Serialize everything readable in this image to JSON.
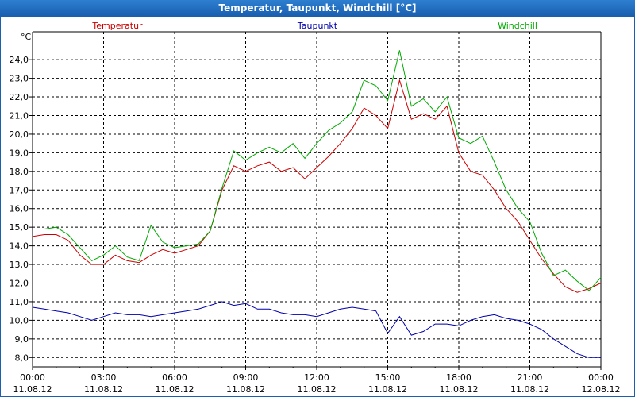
{
  "window": {
    "title": "Temperatur, Taupunkt, Windchill [°C]"
  },
  "colors": {
    "temperatur": "#cc0000",
    "taupunkt": "#0000aa",
    "windchill": "#00aa00"
  },
  "chart_data": {
    "type": "line",
    "yunit": "°C",
    "ylim": [
      7.5,
      25.5
    ],
    "yticks": [
      "8,0",
      "9,0",
      "10,0",
      "11,0",
      "12,0",
      "13,0",
      "14,0",
      "15,0",
      "16,0",
      "17,0",
      "18,0",
      "19,0",
      "20,0",
      "21,0",
      "22,0",
      "23,0",
      "24,0"
    ],
    "ytick_values": [
      8,
      9,
      10,
      11,
      12,
      13,
      14,
      15,
      16,
      17,
      18,
      19,
      20,
      21,
      22,
      23,
      24
    ],
    "xlim": [
      0,
      24
    ],
    "xticks": [
      {
        "x": 0,
        "time": "00:00",
        "date": "11.08.12"
      },
      {
        "x": 3,
        "time": "03:00",
        "date": "11.08.12"
      },
      {
        "x": 6,
        "time": "06:00",
        "date": "11.08.12"
      },
      {
        "x": 9,
        "time": "09:00",
        "date": "11.08.12"
      },
      {
        "x": 12,
        "time": "12:00",
        "date": "11.08.12"
      },
      {
        "x": 15,
        "time": "15:00",
        "date": "11.08.12"
      },
      {
        "x": 18,
        "time": "18:00",
        "date": "11.08.12"
      },
      {
        "x": 21,
        "time": "21:00",
        "date": "11.08.12"
      },
      {
        "x": 24,
        "time": "00:00",
        "date": "12.08.12"
      }
    ],
    "grid": true,
    "x": [
      0,
      0.5,
      1,
      1.5,
      2,
      2.5,
      3,
      3.5,
      4,
      4.5,
      5,
      5.5,
      6,
      6.5,
      7,
      7.5,
      8,
      8.5,
      9,
      9.5,
      10,
      10.5,
      11,
      11.5,
      12,
      12.5,
      13,
      13.5,
      14,
      14.5,
      15,
      15.5,
      16,
      16.5,
      17,
      17.5,
      18,
      18.5,
      19,
      19.5,
      20,
      20.5,
      21,
      21.5,
      22,
      22.5,
      23,
      23.5,
      24
    ],
    "series": [
      {
        "name": "Temperatur",
        "values": [
          14.5,
          14.6,
          14.6,
          14.3,
          13.5,
          13.0,
          13.0,
          13.5,
          13.2,
          13.1,
          13.5,
          13.8,
          13.6,
          13.8,
          14.0,
          14.8,
          17.0,
          18.3,
          18.0,
          18.3,
          18.5,
          18.0,
          18.2,
          17.6,
          18.2,
          18.8,
          19.5,
          20.3,
          21.4,
          21.0,
          20.3,
          22.9,
          20.8,
          21.1,
          20.8,
          21.5,
          19.0,
          18.0,
          17.8,
          17.0,
          16.0,
          15.3,
          14.3,
          13.3,
          12.5,
          11.8,
          11.5,
          11.7,
          12.0
        ]
      },
      {
        "name": "Taupunkt",
        "values": [
          10.7,
          10.6,
          10.5,
          10.4,
          10.2,
          10.0,
          10.2,
          10.4,
          10.3,
          10.3,
          10.2,
          10.3,
          10.4,
          10.5,
          10.6,
          10.8,
          11.0,
          10.8,
          10.9,
          10.6,
          10.6,
          10.4,
          10.3,
          10.3,
          10.2,
          10.4,
          10.6,
          10.7,
          10.6,
          10.5,
          9.3,
          10.2,
          9.2,
          9.4,
          9.8,
          9.8,
          9.7,
          10.0,
          10.2,
          10.3,
          10.1,
          10.0,
          9.8,
          9.5,
          9.0,
          8.6,
          8.2,
          8.0,
          8.0
        ]
      },
      {
        "name": "Windchill",
        "values": [
          14.9,
          14.9,
          15.0,
          14.6,
          13.9,
          13.2,
          13.5,
          14.0,
          13.4,
          13.2,
          15.1,
          14.2,
          13.9,
          14.0,
          14.1,
          14.8,
          17.1,
          19.1,
          18.6,
          19.0,
          19.3,
          19.0,
          19.5,
          18.7,
          19.5,
          20.2,
          20.6,
          21.2,
          22.9,
          22.6,
          21.8,
          24.5,
          21.5,
          21.9,
          21.2,
          22.0,
          19.8,
          19.5,
          19.9,
          18.5,
          17.0,
          16.0,
          15.3,
          13.6,
          12.4,
          12.7,
          12.1,
          11.6,
          12.3
        ]
      }
    ]
  }
}
